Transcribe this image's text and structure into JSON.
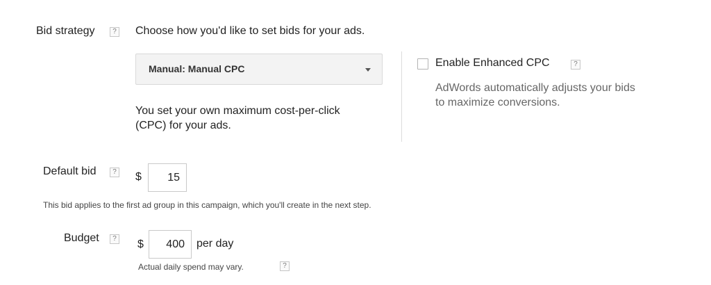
{
  "bid_strategy": {
    "label": "Bid strategy",
    "help": "?",
    "description": "Choose how you'd like to set bids for your ads.",
    "selected": "Manual: Manual CPC",
    "explanation_line1": "You set your own maximum cost-per-click",
    "explanation_line2": "(CPC) for your ads."
  },
  "enhanced_cpc": {
    "label": "Enable Enhanced CPC",
    "help": "?",
    "checked": false,
    "description_line1": "AdWords automatically adjusts your bids",
    "description_line2": "to maximize conversions."
  },
  "default_bid": {
    "label": "Default bid",
    "help": "?",
    "currency": "$",
    "value": "15",
    "note": "This bid applies to the first ad group in this campaign, which you'll create in the next step."
  },
  "budget": {
    "label": "Budget",
    "help": "?",
    "currency": "$",
    "value": "400",
    "unit": "per day",
    "note": "Actual daily spend may vary.",
    "note_help": "?"
  },
  "icons": {
    "help": "question-mark-icon",
    "dropdown": "chevron-down-icon"
  }
}
